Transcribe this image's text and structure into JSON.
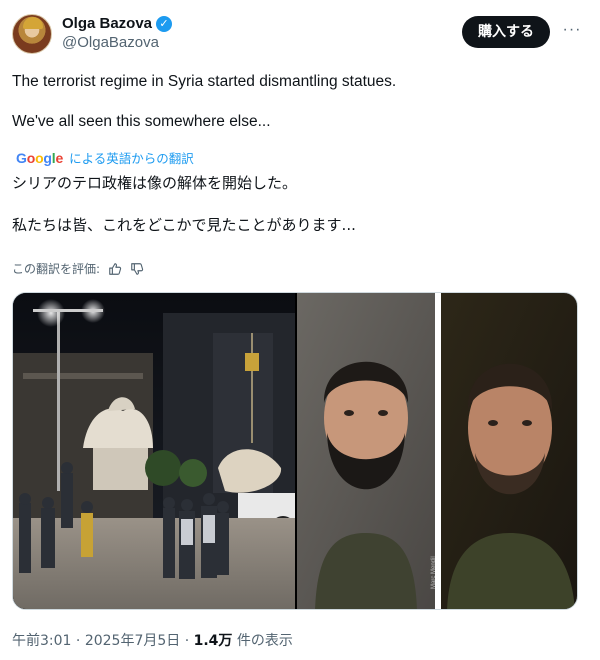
{
  "author": {
    "display_name": "Olga Bazova",
    "handle": "@OlgaBazova",
    "verified_mark": "✓",
    "avatar_icon": "avatar-portrait-icon"
  },
  "header": {
    "buy_label": "購入する",
    "more_icon": "more-horizontal-icon",
    "more_glyph": "···"
  },
  "tweet": {
    "line1": "The terrorist regime in Syria started dismantling statues.",
    "line2": "We've all seen this somewhere else..."
  },
  "translation": {
    "google_g1": "G",
    "google_o1": "o",
    "google_o2": "o",
    "google_g2": "g",
    "google_l": "l",
    "google_e": "e",
    "link_text": "による英語からの翻訳",
    "line1": "シリアのテロ政権は像の解体を開始した。",
    "line2": "私たちは皆、これをどこかで見たことがあります..."
  },
  "rating": {
    "label": "この翻訳を評価:",
    "thumbs_up_icon": "thumbs-up-icon",
    "thumbs_down_icon": "thumbs-down-icon"
  },
  "media": {
    "left_image": "statue-removal-night-photo",
    "right_image": "two-bearded-men-portraits",
    "watermark": "Marc Mendil"
  },
  "footer": {
    "time": "午前3:01",
    "separator": " · ",
    "date": "2025年7月5日",
    "separator2": " · ",
    "views_count": "1.4万",
    "views_label": " 件の表示"
  },
  "colors": {
    "accent": "#1d9bf0",
    "text": "#0f1419",
    "secondary": "#536471",
    "border": "#cfd9de"
  }
}
